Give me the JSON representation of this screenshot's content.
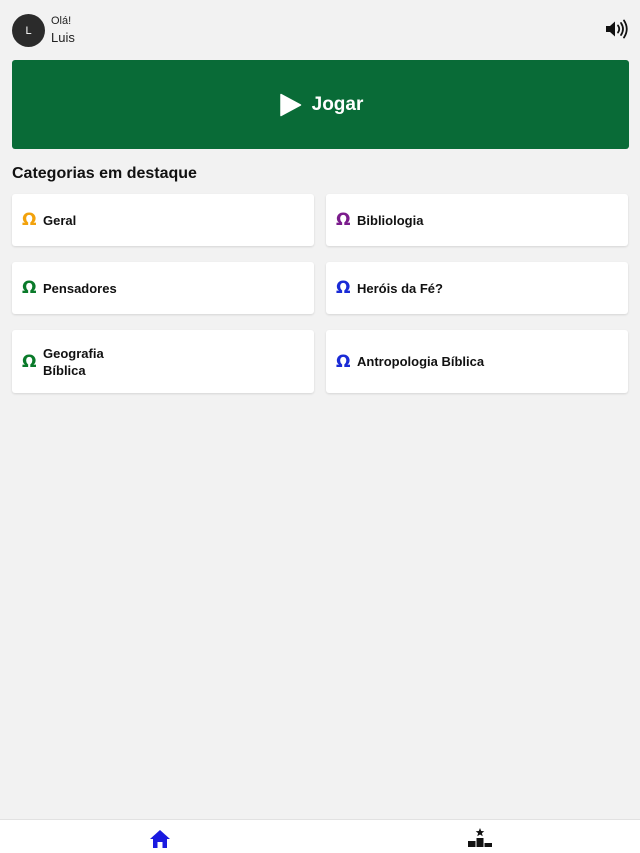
{
  "header": {
    "avatar_initial": "L",
    "greeting": "Olá!",
    "username": "Luis",
    "sound_icon": "volume-icon"
  },
  "play": {
    "label": "Jogar",
    "icon": "play-icon",
    "color": "#096b37"
  },
  "section": {
    "title": "Categorias em destaque"
  },
  "categories": [
    {
      "label": "Geral",
      "icon": "omega-icon",
      "color": "#f2a20c"
    },
    {
      "label": "Bibliologia",
      "icon": "omega-icon",
      "color": "#7b1d8c"
    },
    {
      "label": "Pensadores",
      "icon": "omega-icon",
      "color": "#0a7a2a"
    },
    {
      "label": "Heróis da Fé?",
      "icon": "omega-icon",
      "color": "#1a2bd6"
    },
    {
      "label": "Geografia Bíblica",
      "icon": "omega-icon",
      "color": "#0a7a2a"
    },
    {
      "label": "Antropologia Bíblica",
      "icon": "omega-icon",
      "color": "#1a2bd6"
    }
  ],
  "bottom_nav": {
    "items": [
      {
        "icon": "home-icon",
        "active": true,
        "color": "#1a1ae0"
      },
      {
        "icon": "ranking-podium-icon",
        "active": false,
        "color": "#111111"
      }
    ]
  }
}
